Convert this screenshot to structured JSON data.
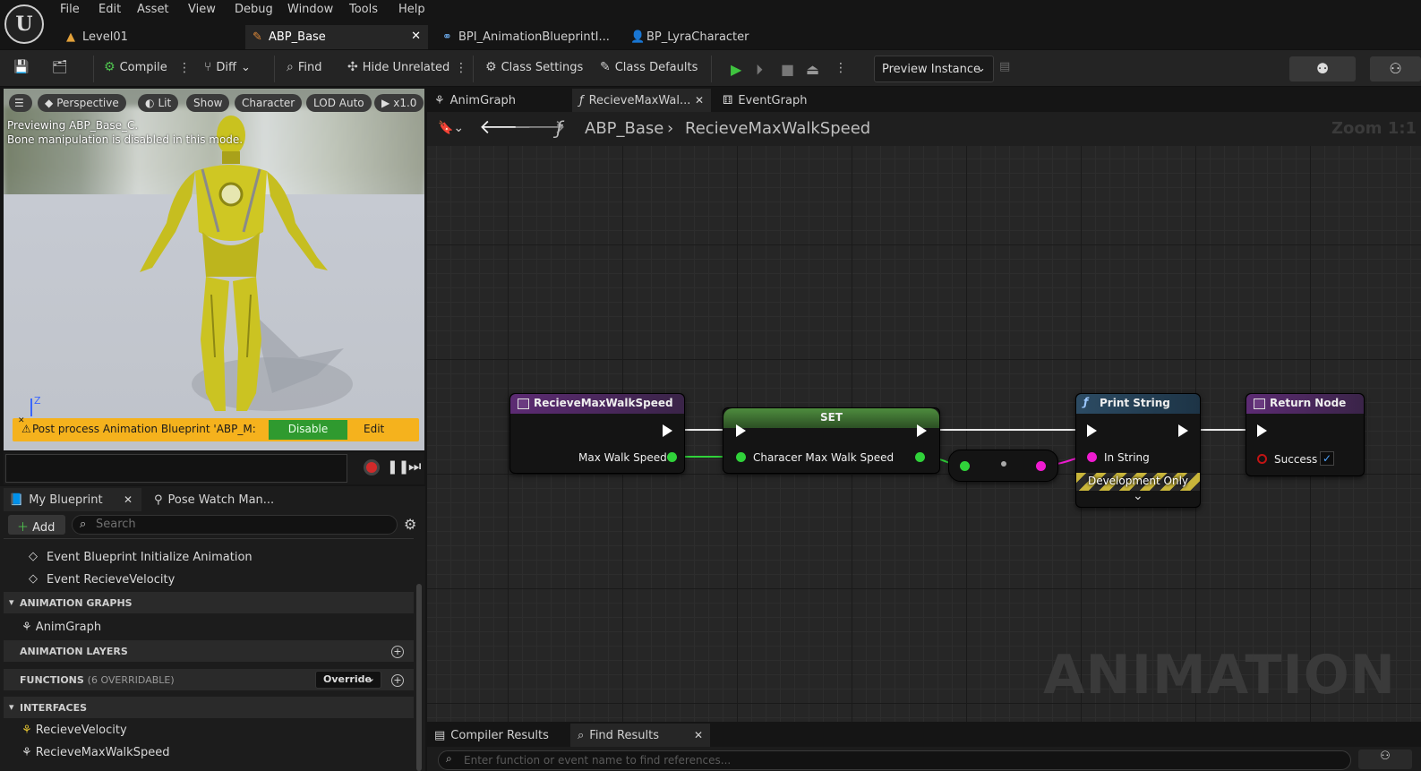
{
  "menu": [
    "File",
    "Edit",
    "Asset",
    "View",
    "Debug",
    "Window",
    "Tools",
    "Help"
  ],
  "doc_tabs": [
    {
      "label": "Level01"
    },
    {
      "label": "ABP_Base"
    },
    {
      "label": "BPI_AnimationBlueprintI..."
    },
    {
      "label": "BP_LyraCharacter"
    }
  ],
  "toolbar": {
    "compile": "Compile",
    "diff": "Diff",
    "find": "Find",
    "hide_unrelated": "Hide Unrelated",
    "class_settings": "Class Settings",
    "class_defaults": "Class Defaults",
    "preview_instance": "Preview Instance"
  },
  "viewport": {
    "perspective": "Perspective",
    "lit": "Lit",
    "show": "Show",
    "character": "Character",
    "lod": "LOD Auto",
    "speed": "x1.0",
    "preview_line1": "Previewing ABP_Base_C.",
    "preview_line2": "Bone manipulation is disabled in this mode.",
    "axis_label": "Z",
    "warning": "Post process Animation Blueprint 'ABP_M:",
    "disable": "Disable",
    "edit": "Edit"
  },
  "my_blueprint": {
    "tab": "My Blueprint",
    "tab2": "Pose Watch Man...",
    "add": "Add",
    "search_placeholder": "Search",
    "events": [
      "Event Blueprint Initialize Animation",
      "Event RecieveVelocity"
    ],
    "sections": {
      "anim_graphs": "ANIMATION GRAPHS",
      "anim_layers": "ANIMATION LAYERS",
      "functions": "FUNCTIONS",
      "functions_sub": "(6 OVERRIDABLE)",
      "interfaces": "INTERFACES"
    },
    "anim_graph_item": "AnimGraph",
    "override": "Override",
    "interface_items": [
      "RecieveVelocity",
      "RecieveMaxWalkSpeed"
    ]
  },
  "graph_tabs": [
    {
      "label": "AnimGraph"
    },
    {
      "label": "RecieveMaxWal..."
    },
    {
      "label": "EventGraph"
    }
  ],
  "breadcrumb": {
    "root": "ABP_Base",
    "leaf": "RecieveMaxWalkSpeed",
    "zoom": "Zoom 1:1"
  },
  "watermark": "ANIMATION",
  "nodes": {
    "entry": {
      "title": "RecieveMaxWalkSpeed",
      "pin": "Max Walk Speed"
    },
    "set": {
      "title": "SET",
      "pin": "Characer Max Walk Speed"
    },
    "print": {
      "title": "Print String",
      "pin": "In String",
      "dev": "Development Only"
    },
    "ret": {
      "title": "Return Node",
      "pin": "Success"
    }
  },
  "colors": {
    "float_pin": "#30d23a",
    "string_pin": "#ef1bd0",
    "bool_pin": "#c11414",
    "func_header": "#2c4b63",
    "entry_header": "#5c2b73",
    "set_header": "#3d6f31"
  },
  "bottom": {
    "compiler": "Compiler Results",
    "find": "Find Results",
    "search_placeholder": "Enter function or event name to find references..."
  }
}
